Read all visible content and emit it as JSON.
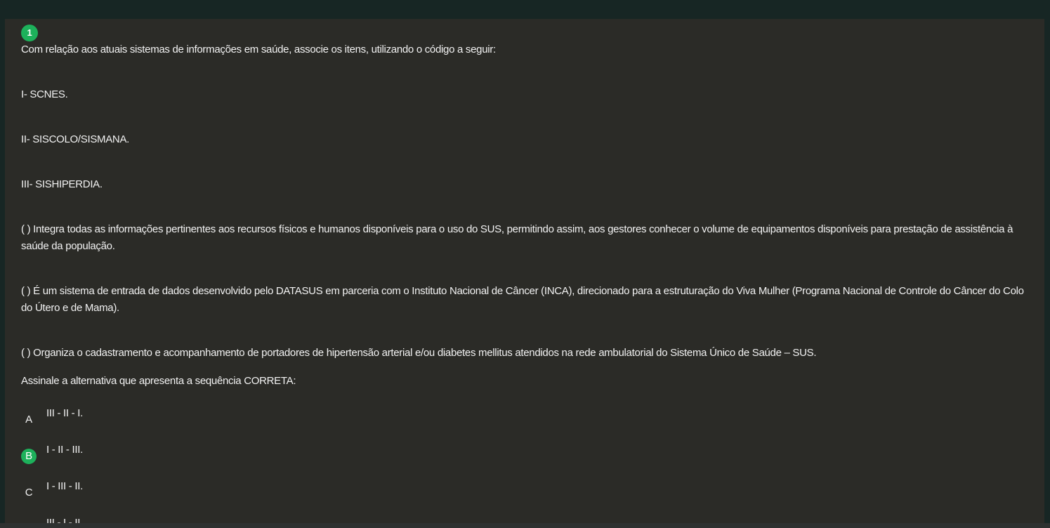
{
  "question": {
    "number": "1",
    "intro": "Com relação aos atuais sistemas de informações em saúde, associe os itens, utilizando o código a seguir:",
    "items": [
      "I- SCNES.",
      "II- SISCOLO/SISMANA.",
      "III- SISHIPERDIA."
    ],
    "statements": [
      "(    ) Integra todas as informações pertinentes aos recursos físicos e humanos disponíveis para o uso do SUS, permitindo assim, aos gestores conhecer o volume de equipamentos disponíveis para prestação de assistência à saúde da população.",
      "(    ) É um sistema de entrada de dados desenvolvido pelo DATASUS em parceria com o Instituto Nacional de Câncer (INCA), direcionado para a estruturação do Viva Mulher (Programa Nacional de Controle do Câncer do Colo do Útero e de Mama).",
      "(    ) Organiza o cadastramento e acompanhamento de portadores de hipertensão arterial e/ou diabetes mellitus atendidos na rede ambulatorial do Sistema Único de Saúde – SUS."
    ],
    "prompt": "Assinale a alternativa que apresenta a sequência CORRETA:",
    "options": [
      {
        "letter": "A",
        "text": "III - II - I.",
        "selected": false
      },
      {
        "letter": "B",
        "text": "I - II - III.",
        "selected": true
      },
      {
        "letter": "C",
        "text": "I - III - II.",
        "selected": false
      },
      {
        "letter": "D",
        "text": "III - I - II.",
        "selected": false
      }
    ]
  },
  "colors": {
    "accent": "#1db15b",
    "card_background": "#2b2b27",
    "page_background": "#172624",
    "text": "#f2f2f2"
  }
}
